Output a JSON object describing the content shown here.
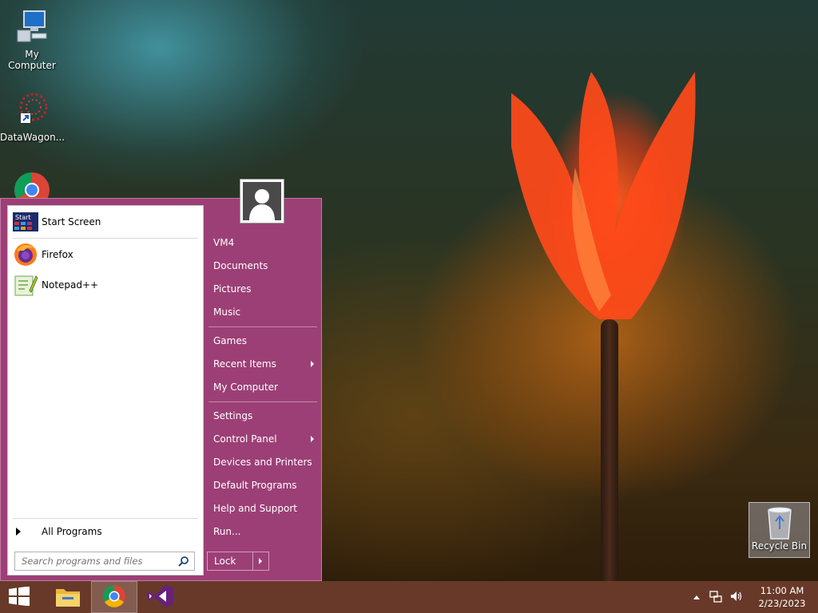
{
  "desktop": {
    "icons": [
      {
        "label": "My Computer"
      },
      {
        "label": "DataWagon..."
      },
      {
        "label": "Recycle Bin"
      }
    ]
  },
  "start_menu": {
    "programs": [
      {
        "label": "Start Screen",
        "icon": "start-screen-icon",
        "icon_text": "Start"
      },
      {
        "label": "Firefox",
        "icon": "firefox-icon"
      },
      {
        "label": "Notepad++",
        "icon": "notepadpp-icon"
      }
    ],
    "all_programs": "All Programs",
    "search": {
      "placeholder": "Search programs and files"
    },
    "right_items": [
      {
        "label": "VM4"
      },
      {
        "label": "Documents"
      },
      {
        "label": "Pictures"
      },
      {
        "label": "Music"
      },
      {
        "label": "Games"
      },
      {
        "label": "Recent Items",
        "submenu": true
      },
      {
        "label": "My Computer"
      },
      {
        "label": "Settings"
      },
      {
        "label": "Control Panel",
        "submenu": true
      },
      {
        "label": "Devices and Printers"
      },
      {
        "label": "Default Programs"
      },
      {
        "label": "Help and Support"
      },
      {
        "label": "Run..."
      }
    ],
    "lock_label": "Lock"
  },
  "taskbar": {
    "apps": [
      "windows-start-icon",
      "file-explorer-icon",
      "chrome-icon",
      "visual-studio-icon"
    ],
    "clock": {
      "time": "11:00 AM",
      "date": "2/23/2023"
    }
  },
  "colors": {
    "menu_accent": "#9c3f76",
    "taskbar": "#6e3c2d"
  }
}
